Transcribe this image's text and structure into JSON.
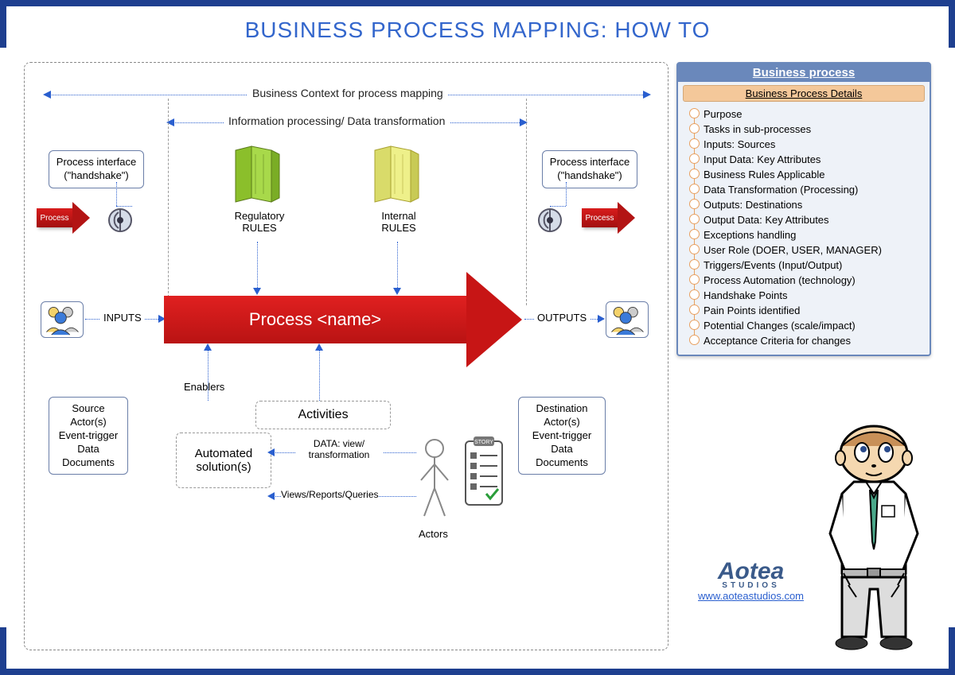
{
  "title": "BUSINESS PROCESS MAPPING: HOW TO",
  "spans": {
    "context": "Business Context for process mapping",
    "info": "Information processing/ Data transformation"
  },
  "handshake_left": "Process interface (\"handshake\")",
  "handshake_right": "Process interface (\"handshake\")",
  "small_process_left": "Process",
  "small_process_right": "Process",
  "rules_reg": "Regulatory RULES",
  "rules_int": "Internal RULES",
  "inputs_label": "INPUTS",
  "outputs_label": "OUTPUTS",
  "process_name": "Process <name>",
  "source_box": "Source\nActor(s)\nEvent-trigger\nData\nDocuments",
  "dest_box": "Destination\nActor(s)\nEvent-trigger\nData\nDocuments",
  "enablers": "Enablers",
  "activities": "Activities",
  "automated": "Automated solution(s)",
  "data_view": "DATA: view/ transformation",
  "views_reports": "Views/Reports/Queries",
  "actors": "Actors",
  "clipboard_tag": "STORY",
  "panel": {
    "title": "Business process",
    "subtitle": "Business Process Details",
    "items": [
      "Purpose",
      "Tasks in sub-processes",
      "Inputs: Sources",
      "Input Data: Key Attributes",
      "Business Rules Applicable",
      "Data Transformation (Processing)",
      "Outputs: Destinations",
      "Output Data: Key Attributes",
      "Exceptions handling",
      "User Role (DOER, USER, MANAGER)",
      "Triggers/Events (Input/Output)",
      "Process Automation (technology)",
      "Handshake Points",
      "Pain Points identified",
      "Potential Changes (scale/impact)",
      "Acceptance Criteria for changes"
    ]
  },
  "logo": {
    "name": "Aotea",
    "sub": "STUDIOS",
    "url": "www.aoteastudios.com"
  }
}
